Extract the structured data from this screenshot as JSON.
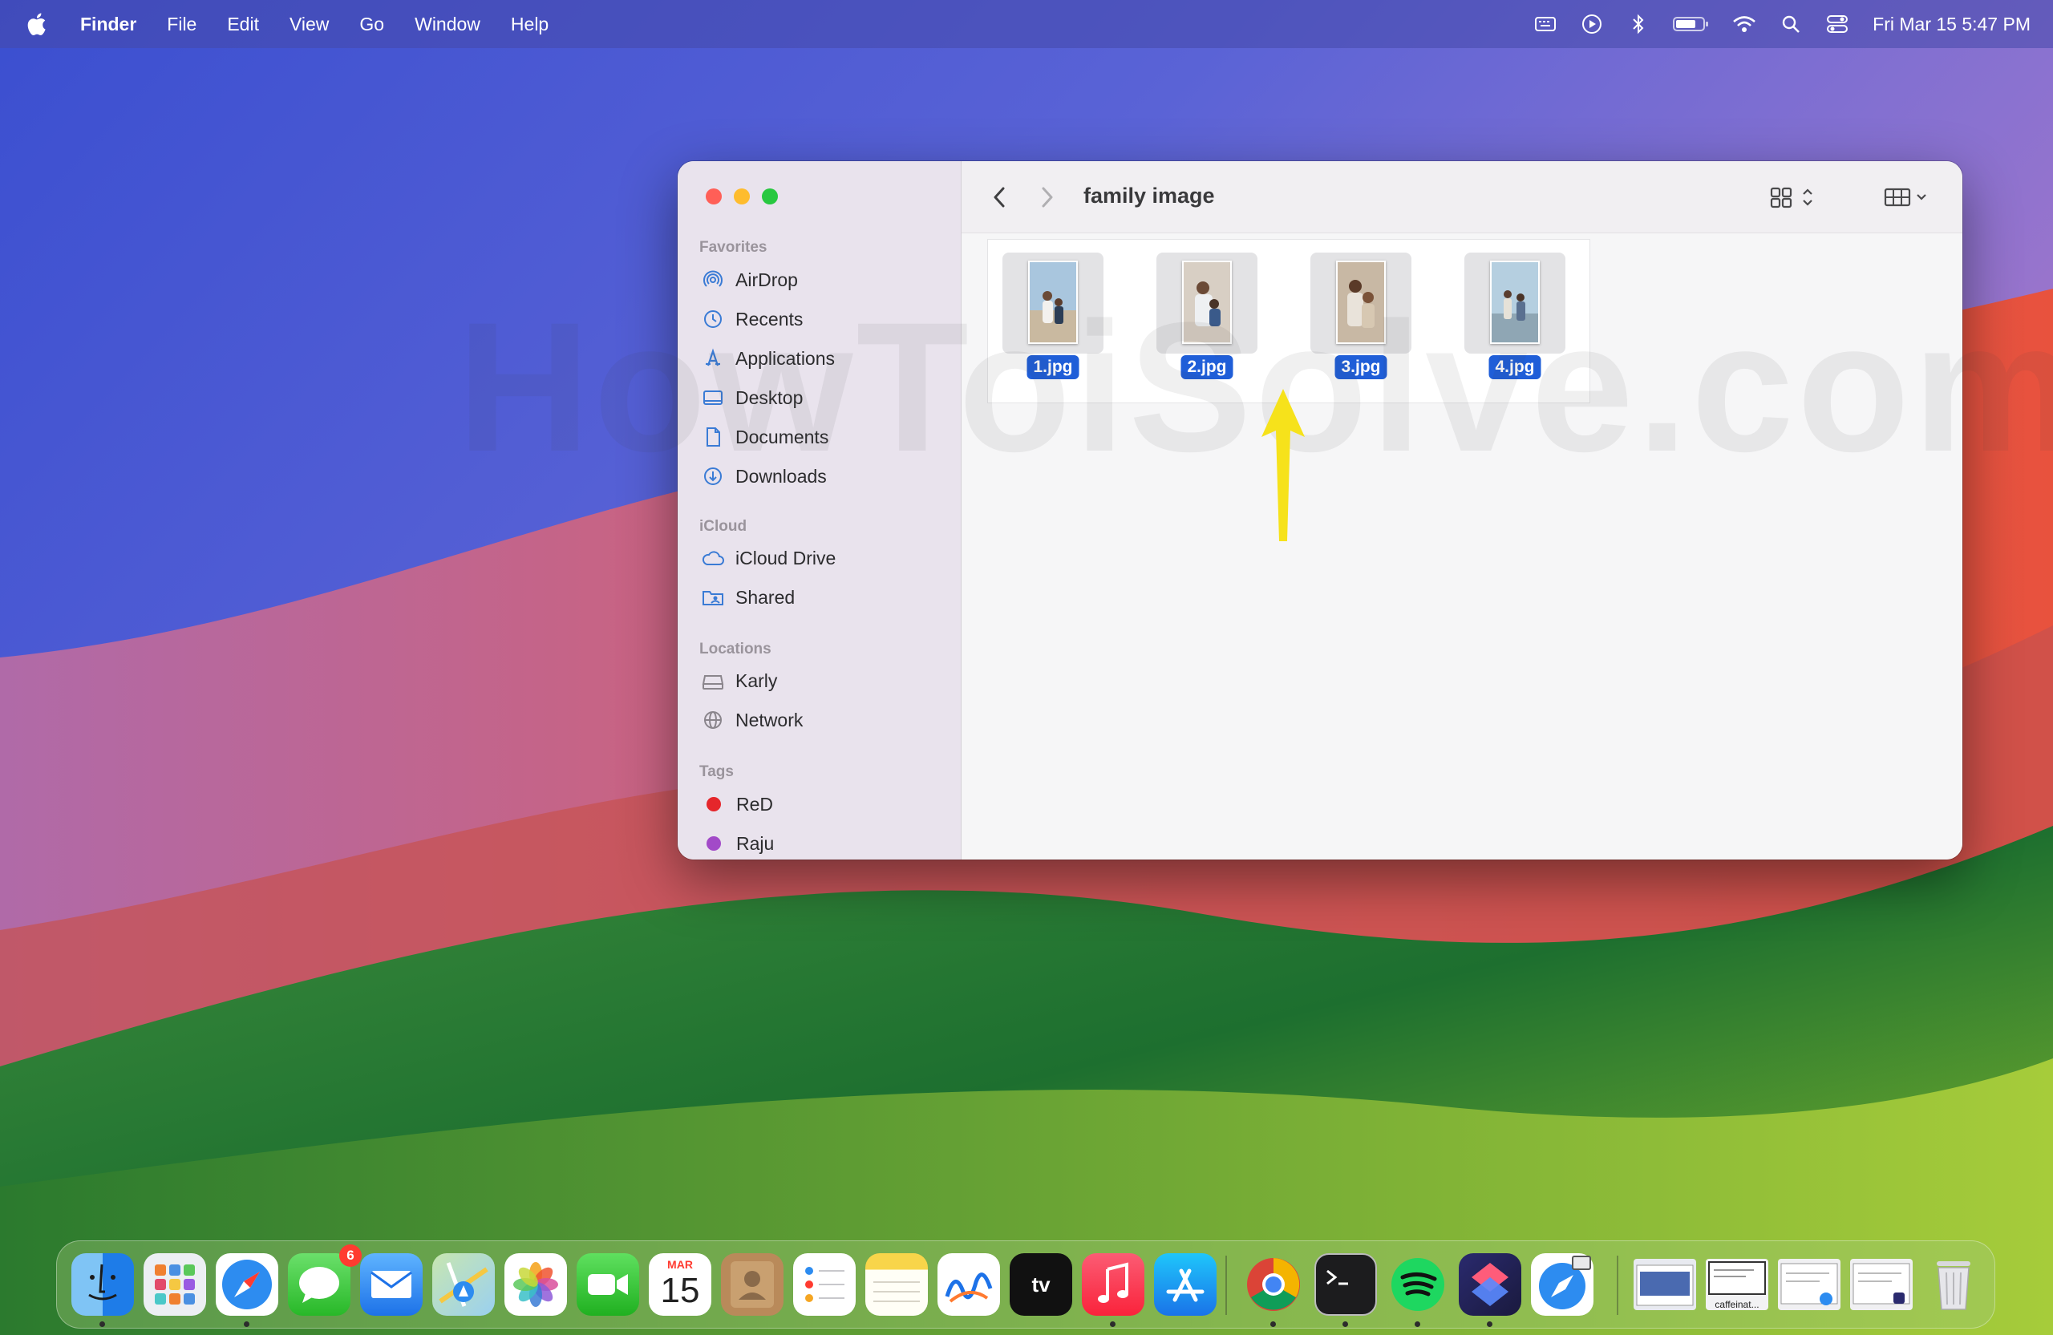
{
  "menubar": {
    "app_name": "Finder",
    "items": [
      "File",
      "Edit",
      "View",
      "Go",
      "Window",
      "Help"
    ],
    "status_icons": [
      "keyboard-icon",
      "play-icon",
      "bluetooth-icon",
      "battery-icon",
      "wifi-icon",
      "search-icon",
      "control-center-icon"
    ],
    "clock": "Fri Mar 15  5:47 PM"
  },
  "finder": {
    "title": "family image",
    "sidebar": {
      "favorites_title": "Favorites",
      "favorites": [
        "AirDrop",
        "Recents",
        "Applications",
        "Desktop",
        "Documents",
        "Downloads"
      ],
      "icloud_title": "iCloud",
      "icloud": [
        "iCloud Drive",
        "Shared"
      ],
      "locations_title": "Locations",
      "locations": [
        "Karly",
        "Network"
      ],
      "tags_title": "Tags",
      "tags": [
        {
          "label": "ReD",
          "color": "#e5262b"
        },
        {
          "label": "Raju",
          "color": "#a24ac8"
        }
      ]
    },
    "files": [
      "1.jpg",
      "2.jpg",
      "3.jpg",
      "4.jpg"
    ],
    "selection_color": "#1f5ed8"
  },
  "watermark": "HowToiSolve.com",
  "dock": {
    "calendar": {
      "month": "MAR",
      "day": "15"
    },
    "messages_badge": "6",
    "caffeinate_label": "caffeinat...",
    "apps": [
      "finder",
      "launchpad",
      "safari",
      "messages",
      "mail",
      "maps",
      "photos",
      "facetime",
      "calendar",
      "contacts",
      "reminders",
      "notes",
      "freeform",
      "apple-tv",
      "music",
      "app-store",
      "chrome",
      "terminal",
      "spotify",
      "shortcuts",
      "safari-screen-sharing",
      "window-1",
      "caffeinate-window",
      "window-3",
      "window-4",
      "trash"
    ]
  },
  "colors": {
    "arrow": "#f6e21b",
    "close": "#ff5f57",
    "minimize": "#febc2e",
    "zoom": "#28c840",
    "sidebar_icon": "#3a7bd5"
  }
}
